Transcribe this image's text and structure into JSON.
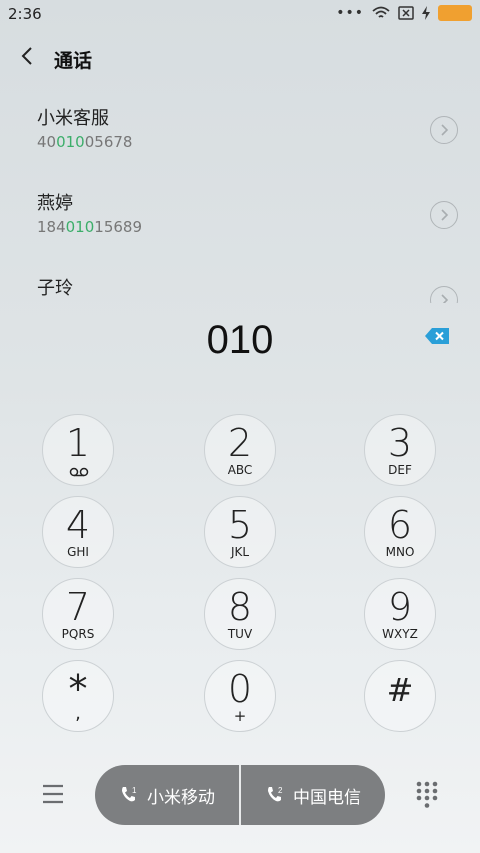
{
  "status": {
    "time": "2:36",
    "icons": [
      "more-dots-icon",
      "wifi-icon",
      "no-sim-icon",
      "charging-icon",
      "battery-icon"
    ]
  },
  "header": {
    "title": "通话"
  },
  "contacts": [
    {
      "name": "小米客服",
      "number_pre": "40",
      "number_match": "010",
      "number_post": "05678"
    },
    {
      "name": "燕婷",
      "number_pre": "184",
      "number_match": "010",
      "number_post": "15689"
    },
    {
      "name": "子玲",
      "number_pre": "",
      "number_match": "",
      "number_post": ""
    }
  ],
  "dial_input": {
    "value": "010"
  },
  "keys": [
    {
      "digit": "1",
      "letters": ""
    },
    {
      "digit": "2",
      "letters": "ABC"
    },
    {
      "digit": "3",
      "letters": "DEF"
    },
    {
      "digit": "4",
      "letters": "GHI"
    },
    {
      "digit": "5",
      "letters": "JKL"
    },
    {
      "digit": "6",
      "letters": "MNO"
    },
    {
      "digit": "7",
      "letters": "PQRS"
    },
    {
      "digit": "8",
      "letters": "TUV"
    },
    {
      "digit": "9",
      "letters": "WXYZ"
    },
    {
      "digit": "*",
      "letters": ","
    },
    {
      "digit": "0",
      "letters": "+"
    },
    {
      "digit": "#",
      "letters": ""
    }
  ],
  "call_buttons": {
    "sim1_label": "小米移动",
    "sim2_label": "中国电信"
  },
  "colors": {
    "match_highlight": "#3cae6a",
    "delete_key": "#2a9fd8",
    "battery": "#f0a030",
    "call_button_bg": "#7d7f81"
  }
}
